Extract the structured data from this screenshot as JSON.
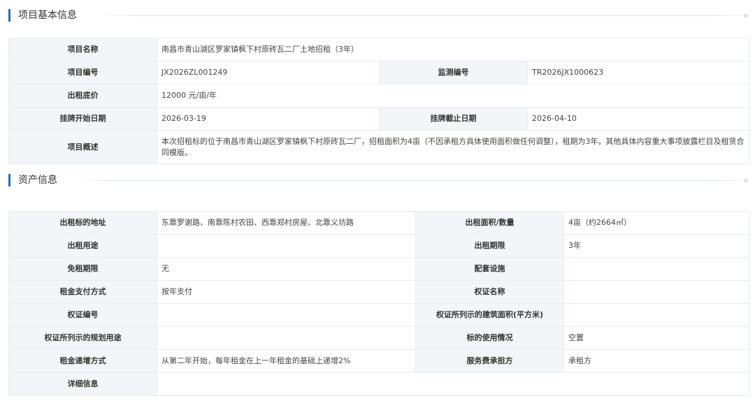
{
  "sections": {
    "basic": {
      "title": "项目基本信息"
    },
    "asset": {
      "title": "资产信息"
    }
  },
  "basic": {
    "name_label": "项目名称",
    "name_value": "南昌市青山湖区罗家镇枫下村原砖瓦二厂土地招租（3年）",
    "code_label": "项目编号",
    "code_value": "JX2026ZL001249",
    "monitor_label": "监测编号",
    "monitor_value": "TR2026JX1000623",
    "price_label": "出租底价",
    "price_value": "12000 元/亩/年",
    "start_label": "挂牌开始日期",
    "start_value": "2026-03-19",
    "end_label": "挂牌截止日期",
    "end_value": "2026-04-10",
    "summary_label": "项目概述",
    "summary_value": "本次招租标的位于南昌市青山湖区罗家镇枫下村原砖瓦二厂，招租面积为4亩（不因承租方具体使用面积做任何调整），租期为3年。其他具体内容重大事项披露栏目及租赁合同模版。"
  },
  "asset": {
    "address_label": "出租标的地址",
    "address_value": "东靠罗谢路、南靠陈村农田、西靠郑村房屋、北靠义坊路",
    "area_label": "出租面积/数量",
    "area_value": "4亩（约2664㎡）",
    "use_label": "出租用途",
    "use_value": "",
    "term_label": "出租期限",
    "term_value": "3年",
    "free_label": "免租期限",
    "free_value": "无",
    "facility_label": "配套设施",
    "facility_value": "",
    "pay_label": "租金支付方式",
    "pay_value": "按年支付",
    "cert_name_label": "权证名称",
    "cert_name_value": "",
    "cert_no_label": "权证编号",
    "cert_no_value": "",
    "build_area_label": "权证所列示的建筑面积(平方米)",
    "build_area_value": "",
    "plan_use_label": "权证所列示的规划用途",
    "plan_use_value": "",
    "usage_label": "标的使用情况",
    "usage_value": "空置",
    "increase_label": "租金递增方式",
    "increase_value": "从第二年开始，每年租金在上一年租金的基础上递增2%",
    "service_label": "服务费承担方",
    "service_value": "承租方",
    "detail_label": "详细信息",
    "detail_value": ""
  }
}
